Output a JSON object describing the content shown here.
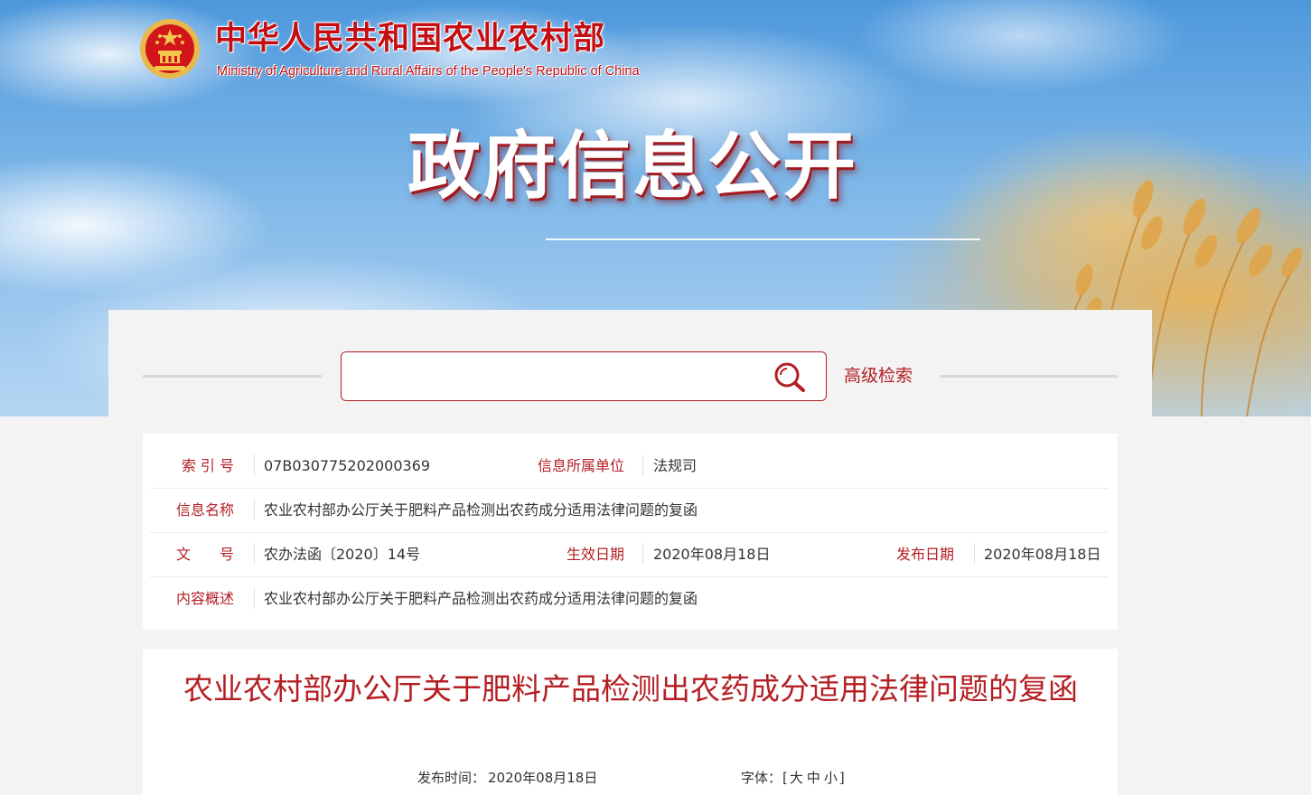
{
  "header": {
    "ministry_name_cn": "中华人民共和国农业农村部",
    "ministry_name_en": "Ministry of Agriculture and Rural Affairs of the People's Republic of China",
    "section_title": "政府信息公开",
    "emblem_icon": "national-emblem-icon"
  },
  "search": {
    "value": "",
    "placeholder": "",
    "button_icon": "search-icon",
    "advanced_label": "高级检索"
  },
  "metadata": {
    "index_label": "索 引 号",
    "index_value": "07B030775202000369",
    "unit_label": "信息所属单位",
    "unit_value": "法规司",
    "name_label": "信息名称",
    "name_value": "农业农村部办公厅关于肥料产品检测出农药成分适用法律问题的复函",
    "docno_label": "文　　号",
    "docno_value": "农办法函〔2020〕14号",
    "effective_label": "生效日期",
    "effective_value": "2020年08月18日",
    "publish_label": "发布日期",
    "publish_value": "2020年08月18日",
    "summary_label": "内容概述",
    "summary_value": "农业农村部办公厅关于肥料产品检测出农药成分适用法律问题的复函"
  },
  "article": {
    "title": "农业农村部办公厅关于肥料产品检测出农药成分适用法律问题的复函",
    "publish_time_label": "发布时间：",
    "publish_time_value": "2020年08月18日",
    "font_size_label": "字体：",
    "font_open_bracket": "[",
    "font_large": "大",
    "font_medium": "中",
    "font_small": "小",
    "font_close_bracket": "]"
  },
  "colors": {
    "accent": "#b41e23",
    "ministry_red": "#c40e12",
    "sky_blue": "#4d98dc",
    "wheat_gold": "#e9b256",
    "panel_bg": "#f3f3f3"
  }
}
